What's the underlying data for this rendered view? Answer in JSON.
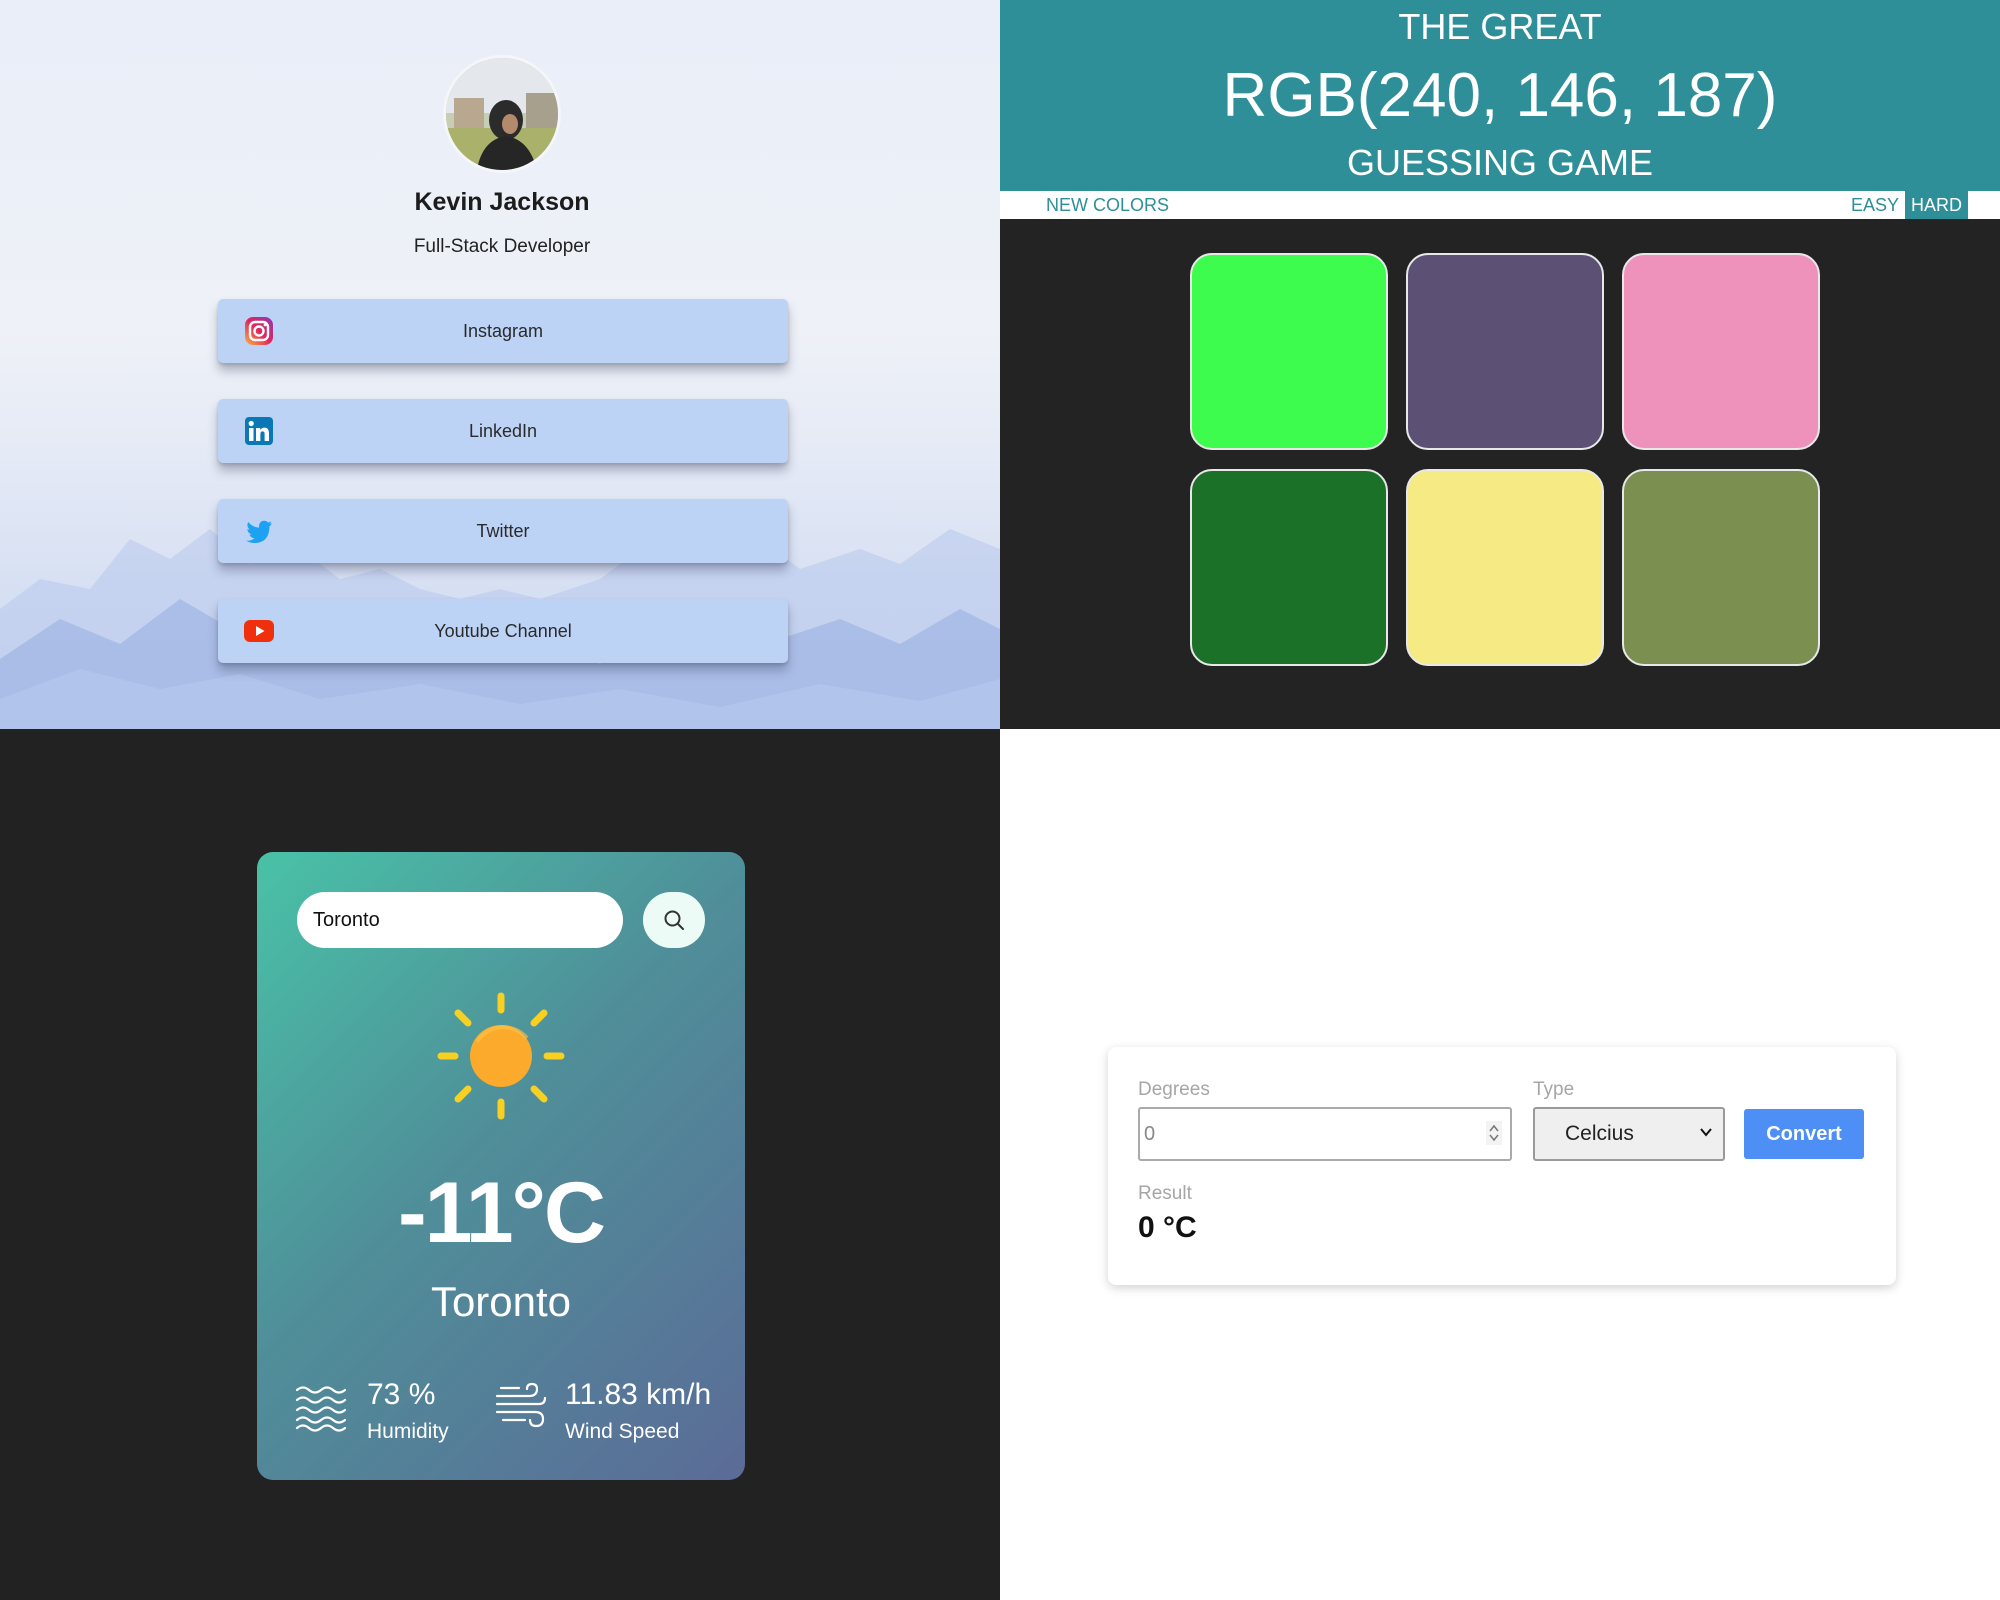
{
  "profile": {
    "name": "Kevin Jackson",
    "role": "Full-Stack Developer",
    "links": [
      {
        "label": "Instagram",
        "icon": "instagram-icon"
      },
      {
        "label": "LinkedIn",
        "icon": "linkedin-icon"
      },
      {
        "label": "Twitter",
        "icon": "twitter-icon"
      },
      {
        "label": "Youtube Channel",
        "icon": "youtube-icon"
      }
    ]
  },
  "color_game": {
    "title_top": "THE GREAT",
    "rgb_display": "RGB(240, 146, 187)",
    "title_bottom": "GUESSING GAME",
    "new_colors_label": "NEW COLORS",
    "easy_label": "EASY",
    "hard_label": "HARD",
    "active_mode": "HARD",
    "header_color": "#2e8f98",
    "squares": [
      "#3dfc4d",
      "#5d5075",
      "#ef92bb",
      "#1a7127",
      "#f6ea84",
      "#7a8f50"
    ]
  },
  "weather": {
    "search_value": "Toronto",
    "temperature": "-11°C",
    "city": "Toronto",
    "humidity_value": "73 %",
    "humidity_label": "Humidity",
    "wind_value": "11.83 km/h",
    "wind_label": "Wind Speed",
    "icon": "sun-icon"
  },
  "converter": {
    "degrees_label": "Degrees",
    "degrees_value": "0",
    "type_label": "Type",
    "type_selected": "Celcius",
    "convert_label": "Convert",
    "result_label": "Result",
    "result_value": "0 °C",
    "accent": "#4d8ff4"
  }
}
